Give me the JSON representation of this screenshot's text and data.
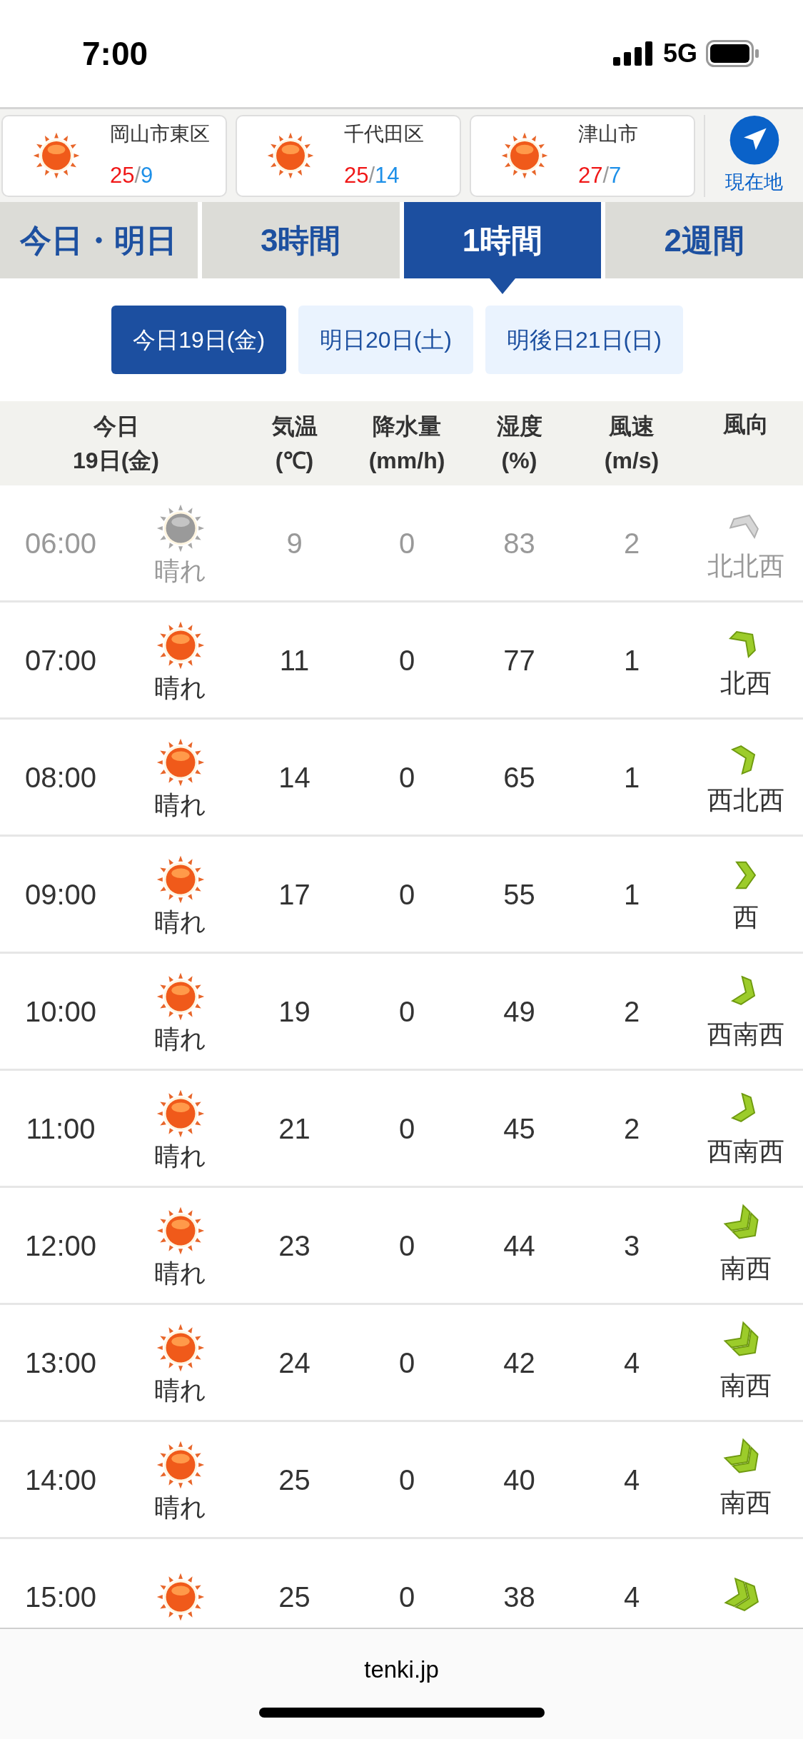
{
  "status_bar": {
    "time": "7:00",
    "network": "5G"
  },
  "locations": [
    {
      "name": "岡山市東区",
      "high": "25",
      "separator": "/",
      "low": "9"
    },
    {
      "name": "千代田区",
      "high": "25",
      "separator": "/",
      "low": "14"
    },
    {
      "name": "津山市",
      "high": "27",
      "separator": "/",
      "low": "7"
    }
  ],
  "current_location": {
    "label": "現在地"
  },
  "tabs": [
    {
      "label": "今日・明日",
      "selected": false
    },
    {
      "label": "3時間",
      "selected": false
    },
    {
      "label": "1時間",
      "selected": true
    },
    {
      "label": "2週間",
      "selected": false
    }
  ],
  "days": [
    {
      "label": "今日19日(金)",
      "selected": true
    },
    {
      "label": "明日20日(土)",
      "selected": false
    },
    {
      "label": "明後日21日(日)",
      "selected": false
    }
  ],
  "table": {
    "columns": [
      [
        "今日",
        "19日(金)"
      ],
      [
        "気温",
        "(℃)"
      ],
      [
        "降水量",
        "(mm/h)"
      ],
      [
        "湿度",
        "(%)"
      ],
      [
        "風速",
        "(m/s)"
      ],
      [
        "風向"
      ]
    ],
    "rows": [
      {
        "time": "06:00",
        "past": true,
        "weather": "晴れ",
        "temp": "9",
        "precip": "0",
        "humidity": "83",
        "wind_speed": "2",
        "wind_icon": {
          "kind": "nnw1"
        },
        "wind_dir": "北北西"
      },
      {
        "time": "07:00",
        "past": false,
        "weather": "晴れ",
        "temp": "11",
        "precip": "0",
        "humidity": "77",
        "wind_speed": "1",
        "wind_icon": {
          "kind": "nw1"
        },
        "wind_dir": "北西"
      },
      {
        "time": "08:00",
        "past": false,
        "weather": "晴れ",
        "temp": "14",
        "precip": "0",
        "humidity": "65",
        "wind_speed": "1",
        "wind_icon": {
          "kind": "wnw1"
        },
        "wind_dir": "西北西"
      },
      {
        "time": "09:00",
        "past": false,
        "weather": "晴れ",
        "temp": "17",
        "precip": "0",
        "humidity": "55",
        "wind_speed": "1",
        "wind_icon": {
          "kind": "w1"
        },
        "wind_dir": "西"
      },
      {
        "time": "10:00",
        "past": false,
        "weather": "晴れ",
        "temp": "19",
        "precip": "0",
        "humidity": "49",
        "wind_speed": "2",
        "wind_icon": {
          "kind": "wsw1"
        },
        "wind_dir": "西南西"
      },
      {
        "time": "11:00",
        "past": false,
        "weather": "晴れ",
        "temp": "21",
        "precip": "0",
        "humidity": "45",
        "wind_speed": "2",
        "wind_icon": {
          "kind": "wsw1"
        },
        "wind_dir": "西南西"
      },
      {
        "time": "12:00",
        "past": false,
        "weather": "晴れ",
        "temp": "23",
        "precip": "0",
        "humidity": "44",
        "wind_speed": "3",
        "wind_icon": {
          "kind": "sw2"
        },
        "wind_dir": "南西"
      },
      {
        "time": "13:00",
        "past": false,
        "weather": "晴れ",
        "temp": "24",
        "precip": "0",
        "humidity": "42",
        "wind_speed": "4",
        "wind_icon": {
          "kind": "sw2"
        },
        "wind_dir": "南西"
      },
      {
        "time": "14:00",
        "past": false,
        "weather": "晴れ",
        "temp": "25",
        "precip": "0",
        "humidity": "40",
        "wind_speed": "4",
        "wind_icon": {
          "kind": "sw2"
        },
        "wind_dir": "南西"
      },
      {
        "time": "15:00",
        "past": false,
        "temp": "25",
        "precip": "0",
        "humidity": "38",
        "wind_speed": "4",
        "wind_icon": {
          "kind": "wsw2"
        }
      }
    ]
  },
  "footer": {
    "url": "tenki.jp"
  }
}
